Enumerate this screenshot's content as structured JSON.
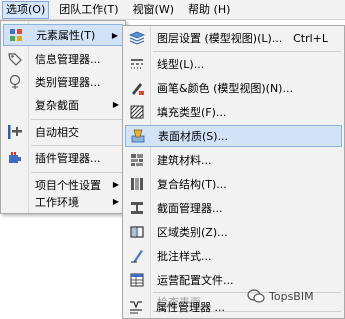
{
  "menubar": {
    "items": [
      {
        "label": "选项(O)"
      },
      {
        "label": "团队工作(T)"
      },
      {
        "label": "视窗(W)"
      },
      {
        "label": "帮助 (H)"
      }
    ]
  },
  "left_menu": {
    "items": [
      {
        "label": "元素属性(T)",
        "icon": "element-attributes-icon"
      },
      {
        "label": "信息管理器...",
        "icon": "tag-icon"
      },
      {
        "label": "类别管理器...",
        "icon": "tree-category-icon"
      },
      {
        "label": "复杂截面",
        "icon": ""
      },
      {
        "label": "自动相交",
        "icon": "auto-intersect-icon"
      },
      {
        "label": "插件管理器...",
        "icon": "plugin-icon"
      },
      {
        "label": "项目个性设置",
        "icon": ""
      },
      {
        "label": "工作环境",
        "icon": ""
      }
    ]
  },
  "right_menu": {
    "items": [
      {
        "label": "图层设置 (模型视图)(L)...",
        "shortcut": "Ctrl+L",
        "icon": "layers-icon"
      },
      {
        "label": "线型(L)...",
        "icon": "line-type-icon"
      },
      {
        "label": "画笔&颜色 (模型视图)(N)...",
        "icon": "pen-color-icon"
      },
      {
        "label": "填充类型(F)...",
        "icon": "fill-type-icon"
      },
      {
        "label": "表面材质(S)...",
        "icon": "surface-material-icon"
      },
      {
        "label": "建筑材料...",
        "icon": "building-material-icon"
      },
      {
        "label": "复合结构(T)...",
        "icon": "composite-icon"
      },
      {
        "label": "截面管理器...",
        "icon": "profile-manager-icon"
      },
      {
        "label": "区域类别(Z)...",
        "icon": "zone-category-icon"
      },
      {
        "label": "批注样式...",
        "icon": "markup-style-icon"
      },
      {
        "label": "运营配置文件...",
        "icon": "operation-profile-icon"
      },
      {
        "label": "检查表面...",
        "icon": ""
      },
      {
        "label": "属性管理器 ...",
        "icon": "property-manager-icon"
      }
    ]
  },
  "watermark": {
    "text": "TopsBIM"
  },
  "colors": {
    "highlight": "#d2e3f8",
    "highlight_border": "#8fb2dd",
    "disabled": "#a0a0a0"
  }
}
